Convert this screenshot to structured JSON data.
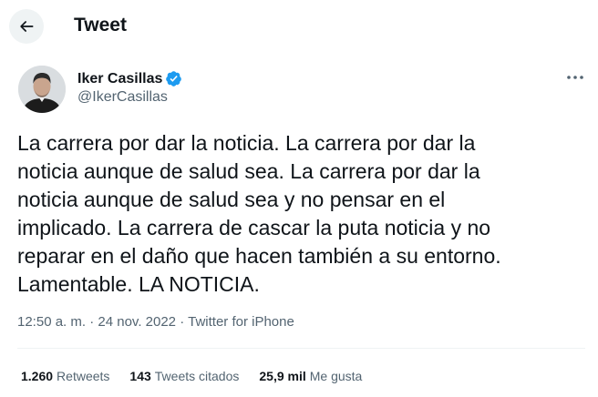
{
  "header": {
    "back_icon": "arrow-left-icon",
    "title": "Tweet"
  },
  "author": {
    "name": "Iker Casillas",
    "handle": "@IkerCasillas",
    "verified_icon": "verified-badge-icon",
    "verified_color": "#1d9bf0"
  },
  "tweet": {
    "text": "La carrera por dar la noticia. La carrera por dar la\nnoticia aunque de salud sea. La carrera por dar la\nnoticia aunque de salud sea y no pensar en el\nimplicado. La carrera de cascar la puta noticia y no\nreparar en el daño que hacen también a su entorno.\nLamentable. LA NOTICIA.",
    "time": "12:50 a. m.",
    "separator": "·",
    "date": "24 nov. 2022",
    "source": "Twitter for iPhone"
  },
  "stats": {
    "retweets_count": "1.260",
    "retweets_label": "Retweets",
    "quotes_count": "143",
    "quotes_label": "Tweets citados",
    "likes_count": "25,9 mil",
    "likes_label": "Me gusta"
  },
  "menu": {
    "more_icon": "more-horizontal-icon"
  }
}
